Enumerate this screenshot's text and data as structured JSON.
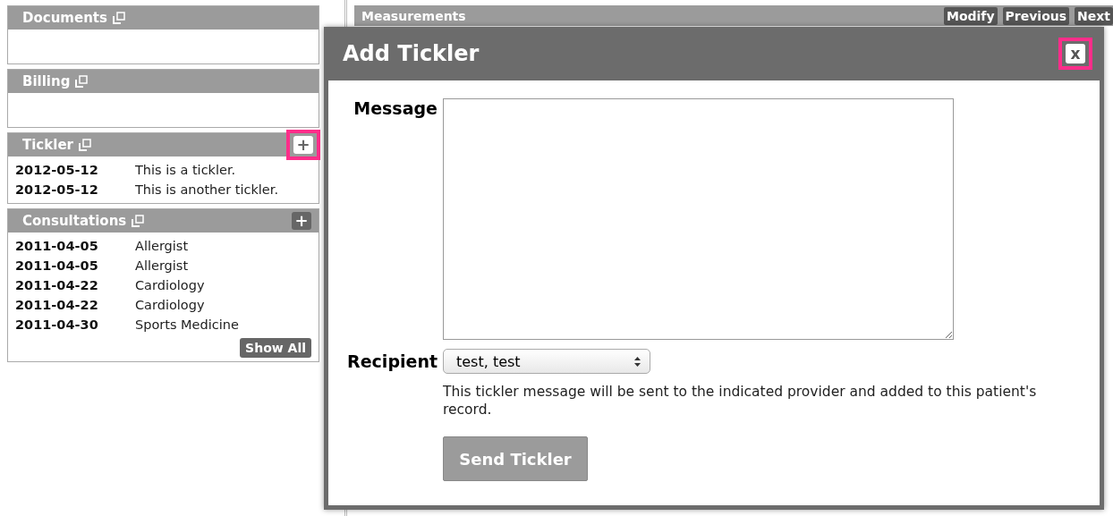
{
  "panels": [
    {
      "title": "Documents",
      "highlighted": false
    },
    {
      "title": "Billing",
      "highlighted": false
    },
    {
      "title": "Tickler",
      "highlighted": true,
      "add_label": "+",
      "rows": [
        {
          "date": "2012-05-12",
          "text": "This is a tickler."
        },
        {
          "date": "2012-05-12",
          "text": "This is another tickler."
        }
      ]
    },
    {
      "title": "Consultations",
      "highlighted": false,
      "add_label": "+",
      "rows": [
        {
          "date": "2011-04-05",
          "text": "Allergist"
        },
        {
          "date": "2011-04-05",
          "text": "Allergist"
        },
        {
          "date": "2011-04-22",
          "text": "Cardiology"
        },
        {
          "date": "2011-04-22",
          "text": "Cardiology"
        },
        {
          "date": "2011-04-30",
          "text": "Sports Medicine"
        }
      ],
      "footer_button": "Show All"
    }
  ],
  "measurements": {
    "title": "Measurements",
    "buttons": [
      "Modify",
      "Previous",
      "Next"
    ]
  },
  "dialog": {
    "title": "Add Tickler",
    "close_label": "x",
    "close_highlighted": true,
    "message_label": "Message",
    "recipient_label": "Recipient",
    "recipient_value": "test, test",
    "help": "This tickler message will be sent to the indicated provider and added to this patient's record.",
    "submit": {
      "label": "Send Tickler",
      "disabled": true
    }
  }
}
